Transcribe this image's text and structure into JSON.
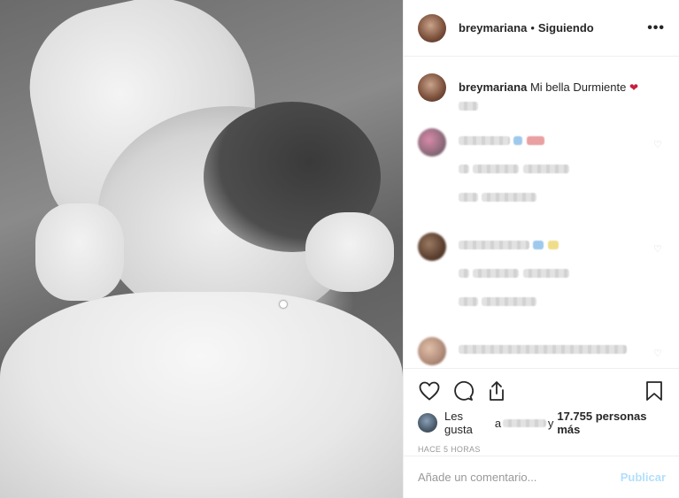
{
  "post": {
    "username": "breymariana",
    "separator": "•",
    "follow_status": "Siguiendo",
    "more_icon": "more-horizontal-icon",
    "caption_user": "breymariana",
    "caption_text": "Mi bella Durmiente",
    "caption_emoji": "❤"
  },
  "actions": {
    "like_icon": "heart-icon",
    "comment_icon": "comment-icon",
    "share_icon": "share-icon",
    "save_icon": "bookmark-icon"
  },
  "likes": {
    "prefix": "Les gusta",
    "first_char": "a",
    "suffix_conj": "y",
    "count": "17.755 personas más"
  },
  "timestamp": "HACE 5 HORAS",
  "comment_box": {
    "placeholder": "Añade un comentario...",
    "post_label": "Publicar"
  },
  "colors": {
    "accent_disabled": "#b2dffc",
    "text": "#262626",
    "muted": "#999999",
    "heart_emoji": "#c81e3c"
  }
}
